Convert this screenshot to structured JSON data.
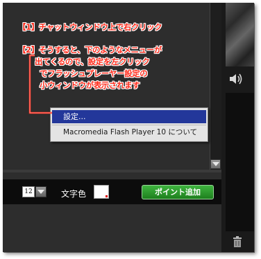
{
  "annotations": {
    "step1": "【1】チャットウィンドウ上で右クリック",
    "step2_lines": [
      "【2】そうすると、下のようなメニューが",
      "出てくるので、設定を左クリック",
      "でフラッシュプレーヤー設定の",
      "小ウィンドウが表示されます"
    ]
  },
  "context_menu": {
    "items": [
      {
        "label": "設定..."
      },
      {
        "label": "Macromedia Flash Player 10 について"
      }
    ]
  },
  "input_bar": {
    "font_size": "12",
    "text_color_label": "文字色",
    "add_point_label": "ポイント追加"
  },
  "colors": {
    "annotation": "#ff2a1a",
    "menu_highlight": "#23379a",
    "add_point_button": "#2a9a2a",
    "background": "#2d2d2d"
  },
  "icons": {
    "scroll": "chevron-down-icon",
    "volume": "speaker-icon",
    "trash": "trash-icon",
    "dropdown": "chevron-down-icon"
  }
}
